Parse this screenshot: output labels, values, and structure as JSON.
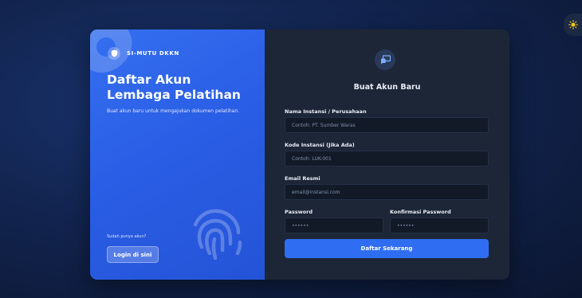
{
  "brand": {
    "name": "SI-MUTU DKKN"
  },
  "left": {
    "title": "Daftar Akun Lembaga Pelatihan",
    "description": "Buat akun baru untuk mengajukan dokumen pelatihan.",
    "have_account": "Sudah punya akun?",
    "login_label": "Login di sini"
  },
  "form": {
    "title": "Buat Akun Baru",
    "fields": {
      "institution": {
        "label": "Nama Instansi / Perusahaan",
        "placeholder": "Contoh: PT. Sumber Waras"
      },
      "code": {
        "label": "Kode Instansi (Jika Ada)",
        "placeholder": "Contoh: LUK-001"
      },
      "email": {
        "label": "Email Resmi",
        "placeholder": "email@instansi.com"
      },
      "password": {
        "label": "Password",
        "placeholder": "••••••"
      },
      "confirm": {
        "label": "Konfirmasi Password",
        "placeholder": "••••••"
      }
    },
    "submit_label": "Daftar Sekarang"
  },
  "colors": {
    "accent": "#2f6df3",
    "panel": "#1d2636",
    "toggle_icon": "#f5c518"
  },
  "icons": {
    "theme": "sun-icon",
    "brand": "shield-icon",
    "form": "chat-icon"
  }
}
